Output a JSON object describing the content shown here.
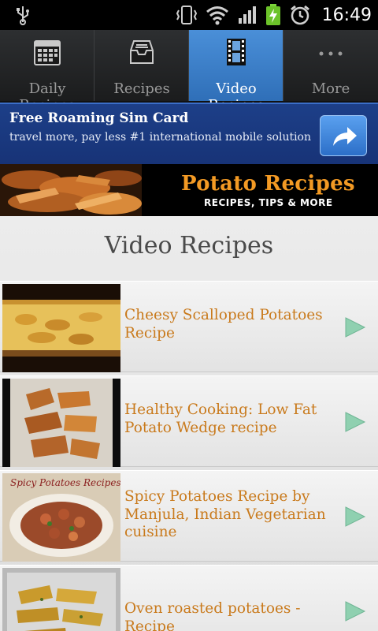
{
  "status_bar": {
    "time": "16:49",
    "icons": [
      "usb-icon",
      "vibrate-icon",
      "wifi-icon",
      "signal-icon",
      "battery-charging-icon",
      "alarm-icon"
    ]
  },
  "tabs": [
    {
      "label": "Daily Recipes",
      "icon": "calendar-icon",
      "active": false
    },
    {
      "label": "Recipes",
      "icon": "inbox-tray-icon",
      "active": false
    },
    {
      "label": "Video Recipes",
      "icon": "film-strip-icon",
      "active": true
    },
    {
      "label": "More",
      "icon": "more-dots-icon",
      "active": false
    }
  ],
  "ad": {
    "title": "Free Roaming Sim Card",
    "subtitle": "travel more, pay less #1 international mobile solution",
    "button_icon": "share-arrow-icon"
  },
  "header": {
    "title": "Potato Recipes",
    "subtitle": "RECIPES, TIPS & MORE"
  },
  "page": {
    "title": "Video Recipes"
  },
  "videos": [
    {
      "title": "Cheesy Scalloped Potatoes Recipe",
      "thumb_text": ""
    },
    {
      "title": "Healthy Cooking: Low Fat Potato Wedge recipe",
      "thumb_text": ""
    },
    {
      "title": "Spicy Potatoes Recipe by Manjula, Indian Vegetarian cuisine",
      "thumb_text": "Spicy Potatoes Recipes"
    },
    {
      "title": "Oven roasted potatoes - Recipe",
      "thumb_text": ""
    }
  ],
  "colors": {
    "active_tab": "#3a7fcc",
    "ad_background": "#1d3f88",
    "header_title": "#f39a24",
    "list_title": "#c97a1c",
    "play_arrow": "#8fd0b0"
  }
}
